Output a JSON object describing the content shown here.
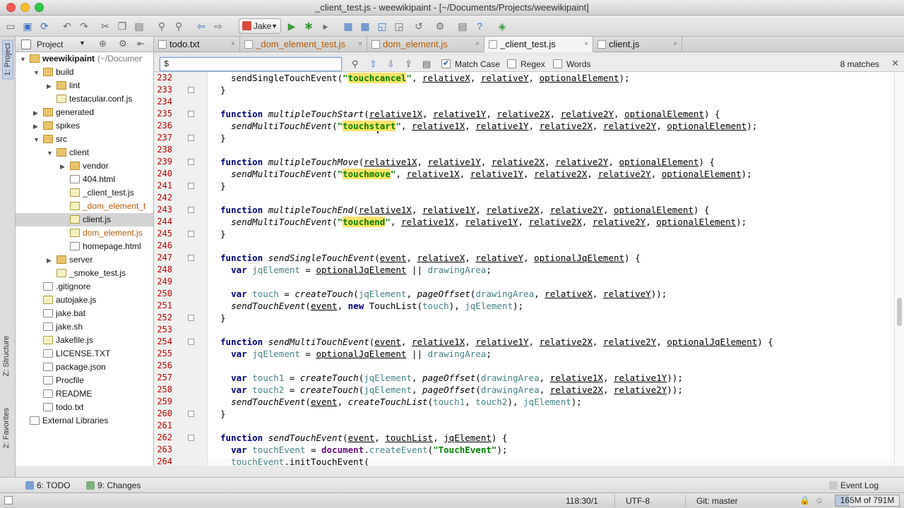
{
  "window": {
    "title": "_client_test.js - weewikipaint - [~/Documents/Projects/weewikipaint]"
  },
  "toolbar": {
    "run_config": "Jake"
  },
  "left_strip": {
    "project_tab": "1: Project",
    "structure_tab": "Z: Structure",
    "favorites_tab": "2: Favorites"
  },
  "project_panel": {
    "header": "Project"
  },
  "tree": [
    {
      "label": "weewikipaint",
      "suffix": "(~/Documer",
      "depth": 0,
      "arrow": "▼",
      "kind": "folder",
      "bold": true
    },
    {
      "label": "build",
      "depth": 1,
      "arrow": "▼",
      "kind": "folder"
    },
    {
      "label": "lint",
      "depth": 2,
      "arrow": "▶",
      "kind": "folder"
    },
    {
      "label": "testacular.conf.js",
      "depth": 2,
      "arrow": "",
      "kind": "js"
    },
    {
      "label": "generated",
      "depth": 1,
      "arrow": "▶",
      "kind": "folder"
    },
    {
      "label": "spikes",
      "depth": 1,
      "arrow": "▶",
      "kind": "folder"
    },
    {
      "label": "src",
      "depth": 1,
      "arrow": "▼",
      "kind": "folder"
    },
    {
      "label": "client",
      "depth": 2,
      "arrow": "▼",
      "kind": "folder"
    },
    {
      "label": "vendor",
      "depth": 3,
      "arrow": "▶",
      "kind": "folder"
    },
    {
      "label": "404.html",
      "depth": 3,
      "arrow": "",
      "kind": "file"
    },
    {
      "label": "_client_test.js",
      "depth": 3,
      "arrow": "",
      "kind": "js"
    },
    {
      "label": "_dom_element_t",
      "depth": 3,
      "arrow": "",
      "kind": "js",
      "modified": true
    },
    {
      "label": "client.js",
      "depth": 3,
      "arrow": "",
      "kind": "js",
      "selected": true
    },
    {
      "label": "dom_element.js",
      "depth": 3,
      "arrow": "",
      "kind": "js",
      "modified": true
    },
    {
      "label": "homepage.html",
      "depth": 3,
      "arrow": "",
      "kind": "file"
    },
    {
      "label": "server",
      "depth": 2,
      "arrow": "▶",
      "kind": "folder"
    },
    {
      "label": "_smoke_test.js",
      "depth": 2,
      "arrow": "",
      "kind": "js"
    },
    {
      "label": ".gitignore",
      "depth": 1,
      "arrow": "",
      "kind": "file"
    },
    {
      "label": "autojake.js",
      "depth": 1,
      "arrow": "",
      "kind": "js"
    },
    {
      "label": "jake.bat",
      "depth": 1,
      "arrow": "",
      "kind": "file"
    },
    {
      "label": "jake.sh",
      "depth": 1,
      "arrow": "",
      "kind": "file"
    },
    {
      "label": "Jakefile.js",
      "depth": 1,
      "arrow": "",
      "kind": "js"
    },
    {
      "label": "LICENSE.TXT",
      "depth": 1,
      "arrow": "",
      "kind": "file"
    },
    {
      "label": "package.json",
      "depth": 1,
      "arrow": "",
      "kind": "file"
    },
    {
      "label": "Procfile",
      "depth": 1,
      "arrow": "",
      "kind": "file"
    },
    {
      "label": "README",
      "depth": 1,
      "arrow": "",
      "kind": "file"
    },
    {
      "label": "todo.txt",
      "depth": 1,
      "arrow": "",
      "kind": "file"
    },
    {
      "label": "External Libraries",
      "depth": 0,
      "arrow": "",
      "kind": "lib"
    }
  ],
  "tabs": [
    {
      "label": "todo.txt",
      "close": "×"
    },
    {
      "label": "_dom_element_test.js",
      "close": "×",
      "modified": true
    },
    {
      "label": "dom_element.js",
      "close": "×",
      "modified": true
    },
    {
      "label": "_client_test.js",
      "close": "×",
      "active": true
    },
    {
      "label": "client.js",
      "close": "×"
    }
  ],
  "find": {
    "query": "$",
    "match_case_label": "Match Case",
    "match_case_checked": true,
    "regex_label": "Regex",
    "words_label": "Words",
    "matches": "8 matches"
  },
  "editor": {
    "lines": [
      {
        "n": "232",
        "html": "  sendSingleTouchEvent(<span class=\"str\">\"<span class=\"hl\">touchcancel</span>\"</span>, <span class=\"p\">relativeX</span>, <span class=\"p\">relativeY</span>, <span class=\"p\">optionalElement</span>);"
      },
      {
        "n": "233",
        "html": "}"
      },
      {
        "n": "234",
        "html": ""
      },
      {
        "n": "235",
        "html": "<span class=\"kw\">function</span> <span class=\"fn\">multipleTouchStart</span>(<span class=\"p\">relative1X</span>, <span class=\"p\">relative1Y</span>, <span class=\"p\">relative2X</span>, <span class=\"p\">relative2Y</span>, <span class=\"p\">optionalElement</span>) {"
      },
      {
        "n": "236",
        "html": "  <span class=\"fn\">sendMultiTouchEvent</span>(<span class=\"str\">\"<span class=\"hl\">touchstart</span>\"</span>, <span class=\"p\">relative1X</span>, <span class=\"p\">relative1Y</span>, <span class=\"p\">relative2X</span>, <span class=\"p\">relative2Y</span>, <span class=\"p\">optionalElement</span>);"
      },
      {
        "n": "237",
        "html": "}"
      },
      {
        "n": "238",
        "html": ""
      },
      {
        "n": "239",
        "html": "<span class=\"kw\">function</span> <span class=\"fn\">multipleTouchMove</span>(<span class=\"p\">relative1X</span>, <span class=\"p\">relative1Y</span>, <span class=\"p\">relative2X</span>, <span class=\"p\">relative2Y</span>, <span class=\"p\">optionalElement</span>) {"
      },
      {
        "n": "240",
        "html": "  <span class=\"fn\">sendMultiTouchEvent</span>(<span class=\"str\">\"<span class=\"hl\">touchmove</span>\"</span>, <span class=\"p\">relative1X</span>, <span class=\"p\">relative1Y</span>, <span class=\"p\">relative2X</span>, <span class=\"p\">relative2Y</span>, <span class=\"p\">optionalElement</span>);"
      },
      {
        "n": "241",
        "html": "}"
      },
      {
        "n": "242",
        "html": ""
      },
      {
        "n": "243",
        "html": "<span class=\"kw\">function</span> <span class=\"fn\">multipleTouchEnd</span>(<span class=\"p\">relative1X</span>, <span class=\"p\">relative1Y</span>, <span class=\"p\">relative2X</span>, <span class=\"p\">relative2Y</span>, <span class=\"p\">optionalElement</span>) {"
      },
      {
        "n": "244",
        "html": "  <span class=\"fn\">sendMultiTouchEvent</span>(<span class=\"str\">\"<span class=\"hl\">touchend</span>\"</span>, <span class=\"p\">relative1X</span>, <span class=\"p\">relative1Y</span>, <span class=\"p\">relative2X</span>, <span class=\"p\">relative2Y</span>, <span class=\"p\">optionalElement</span>);"
      },
      {
        "n": "245",
        "html": "}"
      },
      {
        "n": "246",
        "html": ""
      },
      {
        "n": "247",
        "html": "<span class=\"kw\">function</span> <span class=\"fn\">sendSingleTouchEvent</span>(<span class=\"p\">event</span>, <span class=\"p\">relativeX</span>, <span class=\"p\">relativeY</span>, <span class=\"p\">optionalJqElement</span>) {"
      },
      {
        "n": "248",
        "html": "  <span class=\"kw\">var</span> <span class=\"lv\">jqElement</span> = <span class=\"p\">optionalJqElement</span> || <span class=\"lv\">drawingArea</span>;"
      },
      {
        "n": "249",
        "html": ""
      },
      {
        "n": "250",
        "html": "  <span class=\"kw\">var</span> <span class=\"lv\">touch</span> = <span class=\"fn\">createTouch</span>(<span class=\"lv\">jqElement</span>, <span class=\"fn\">pageOffset</span>(<span class=\"lv\">drawingArea</span>, <span class=\"p\">relativeX</span>, <span class=\"p\">relativeY</span>));"
      },
      {
        "n": "251",
        "html": "  <span class=\"fn\">sendTouchEvent</span>(<span class=\"p\">event</span>, <span class=\"kw\">new</span> TouchList(<span class=\"lv\">touch</span>), <span class=\"lv\">jqElement</span>);"
      },
      {
        "n": "252",
        "html": "}"
      },
      {
        "n": "253",
        "html": ""
      },
      {
        "n": "254",
        "html": "<span class=\"kw\">function</span> <span class=\"fn\">sendMultiTouchEvent</span>(<span class=\"p\">event</span>, <span class=\"p\">relative1X</span>, <span class=\"p\">relative1Y</span>, <span class=\"p\">relative2X</span>, <span class=\"p\">relative2Y</span>, <span class=\"p\">optionalJqElement</span>) {"
      },
      {
        "n": "255",
        "html": "  <span class=\"kw\">var</span> <span class=\"lv\">jqElement</span> = <span class=\"p\">optionalJqElement</span> || <span class=\"lv\">drawingArea</span>;"
      },
      {
        "n": "256",
        "html": ""
      },
      {
        "n": "257",
        "html": "  <span class=\"kw\">var</span> <span class=\"lv\">touch1</span> = <span class=\"fn\">createTouch</span>(<span class=\"lv\">jqElement</span>, <span class=\"fn\">pageOffset</span>(<span class=\"lv\">drawingArea</span>, <span class=\"p\">relative1X</span>, <span class=\"p\">relative1Y</span>));"
      },
      {
        "n": "258",
        "html": "  <span class=\"kw\">var</span> <span class=\"lv\">touch2</span> = <span class=\"fn\">createTouch</span>(<span class=\"lv\">jqElement</span>, <span class=\"fn\">pageOffset</span>(<span class=\"lv\">drawingArea</span>, <span class=\"p\">relative2X</span>, <span class=\"p\">relative2Y</span>));"
      },
      {
        "n": "259",
        "html": "  <span class=\"fn\">sendTouchEvent</span>(<span class=\"p\">event</span>, <span class=\"fn\">createTouchList</span>(<span class=\"lv\">touch1</span>, <span class=\"lv\">touch2</span>), <span class=\"lv\">jqElement</span>);"
      },
      {
        "n": "260",
        "html": "}"
      },
      {
        "n": "261",
        "html": ""
      },
      {
        "n": "262",
        "html": "<span class=\"kw\">function</span> <span class=\"fn\">sendTouchEvent</span>(<span class=\"p\">event</span>, <span class=\"p\">touchList</span>, <span class=\"p\">jqElement</span>) {"
      },
      {
        "n": "263",
        "html": "  <span class=\"kw\">var</span> <span class=\"lv\">touchEvent</span> = <span class=\"gv\"><b>document</b></span>.<span class=\"lv\">createEvent</span>(<span class=\"str\">\"TouchEvent\"</span>);"
      },
      {
        "n": "264",
        "html": "  <span class=\"lv\">touchEvent</span>.initTouchEvent("
      }
    ],
    "fold_lines": [
      "233",
      "235",
      "237",
      "239",
      "241",
      "243",
      "245",
      "247",
      "252",
      "254",
      "260",
      "262"
    ]
  },
  "bottom_tools": {
    "todo": "6: TODO",
    "changes": "9: Changes",
    "event_log": "Event Log"
  },
  "status": {
    "position": "118:30/1",
    "encoding": "UTF-8",
    "vcs": "Git: master",
    "memory": "165M of 791M",
    "memory_fraction": 0.21
  }
}
